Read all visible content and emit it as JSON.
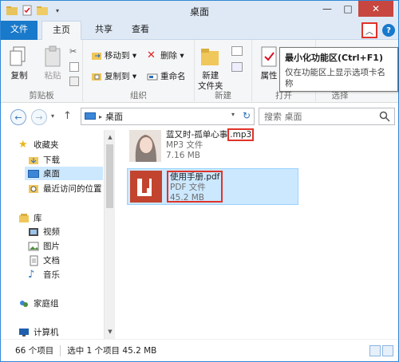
{
  "window": {
    "title": "桌面"
  },
  "title_buttons": {
    "minimize": "—",
    "maximize": "□",
    "close": "✕"
  },
  "tabs": {
    "file": "文件",
    "home": "主页",
    "share": "共享",
    "view": "查看"
  },
  "ribbon": {
    "clipboard": {
      "copy": "复制",
      "paste": "粘贴",
      "label": "剪贴板"
    },
    "organize": {
      "move_to": "移动到 ▾",
      "copy_to": "复制到 ▾",
      "delete": "删除 ▾",
      "rename": "重命名",
      "label": "组织"
    },
    "new": {
      "new_folder_line1": "新建",
      "new_folder_line2": "文件夹",
      "label": "新建"
    },
    "open": {
      "properties": "属性",
      "label": "打开"
    },
    "select": {
      "label": "选择"
    }
  },
  "tooltip": {
    "title": "最小化功能区(Ctrl+F1)",
    "description": "仅在功能区上显示选项卡名称"
  },
  "address": {
    "path": "桌面",
    "search_placeholder": "搜索 桌面"
  },
  "nav_pane": {
    "favorites": "收藏夹",
    "downloads": "下载",
    "desktop": "桌面",
    "recent": "最近访问的位置",
    "libraries": "库",
    "videos": "视频",
    "pictures": "图片",
    "documents": "文档",
    "music": "音乐",
    "homegroup": "家庭组",
    "computer": "计算机"
  },
  "files": [
    {
      "name_base": "蓝又时-孤单心事",
      "name_ext": ".mp3",
      "type": "MP3 文件",
      "size": "7.16 MB"
    },
    {
      "name": "使用手册.pdf",
      "type": "PDF 文件",
      "size": "45.2 MB"
    }
  ],
  "status": {
    "count": "66 个项目",
    "selection": "选中 1 个项目 45.2 MB"
  },
  "colors": {
    "accent": "#1979ca",
    "highlight_red": "#e0332a",
    "selection": "#cce8ff"
  }
}
